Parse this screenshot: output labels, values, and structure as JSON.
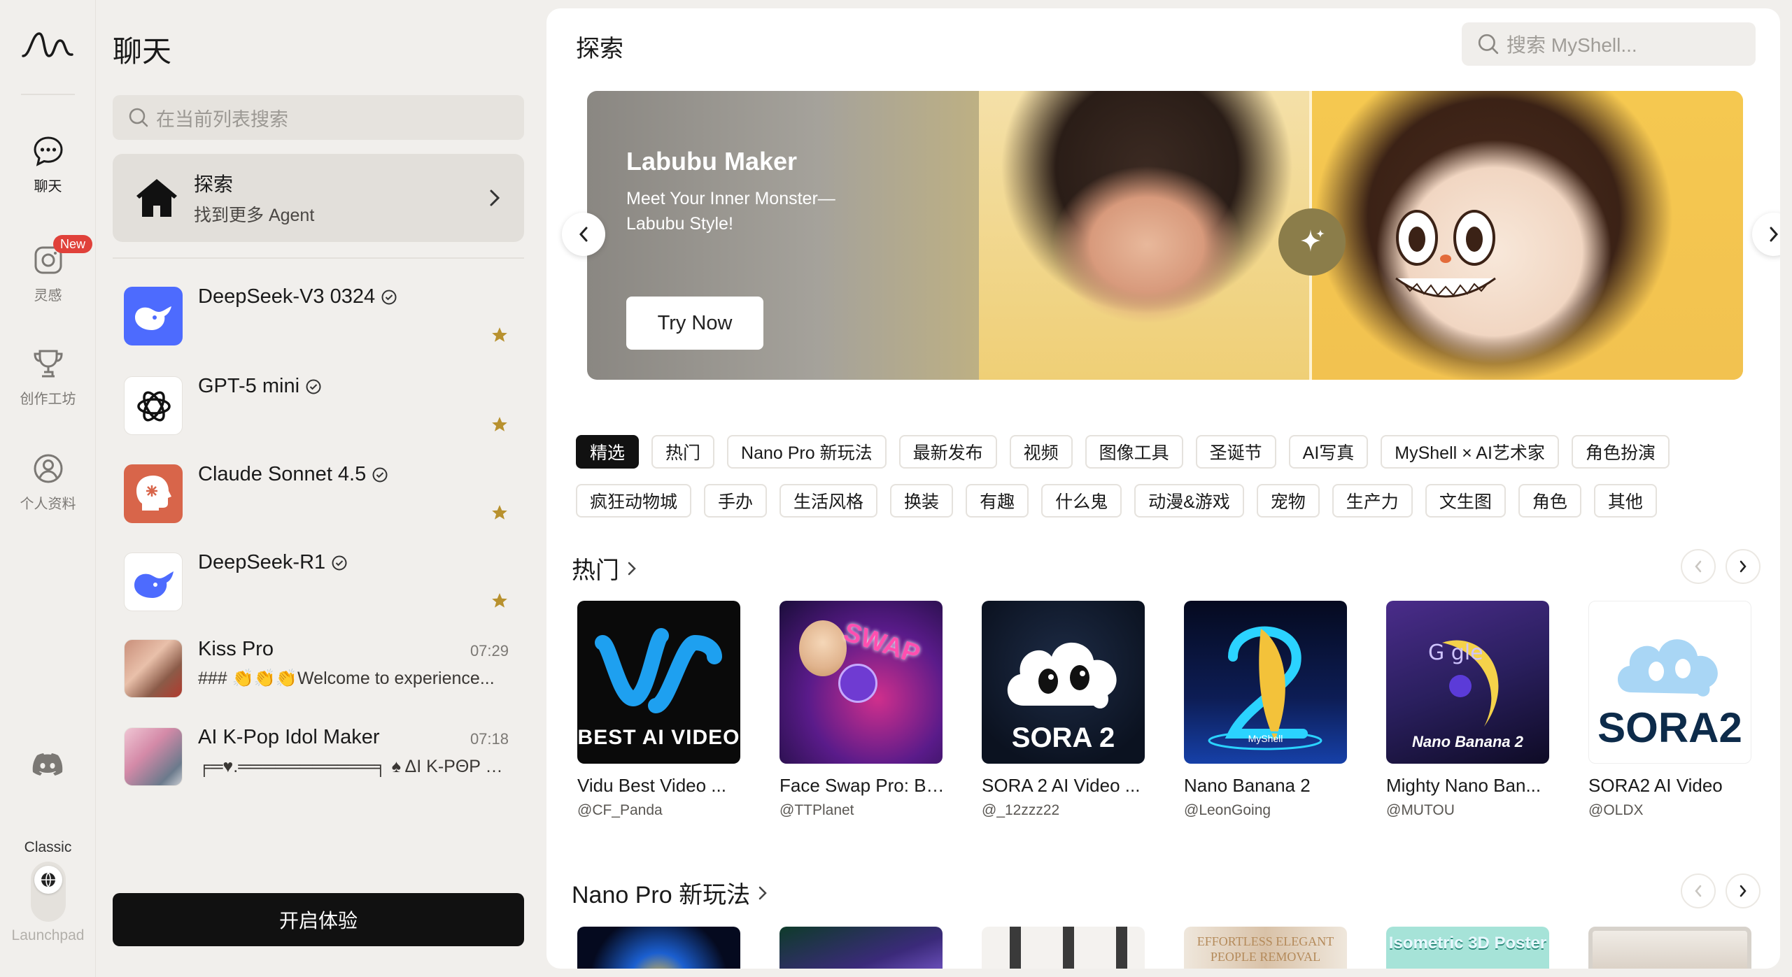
{
  "rail": {
    "items": [
      {
        "label": "聊天",
        "icon": "chat-bubble-icon",
        "active": true
      },
      {
        "label": "灵感",
        "icon": "instagram-icon",
        "badge": "New"
      },
      {
        "label": "创作工坊",
        "icon": "trophy-icon"
      },
      {
        "label": "个人资料",
        "icon": "user-icon"
      }
    ],
    "classic_label": "Classic",
    "launchpad_label": "Launchpad"
  },
  "panel": {
    "title": "聊天",
    "search_placeholder": "在当前列表搜索",
    "explore": {
      "title": "探索",
      "subtitle": "找到更多 Agent"
    },
    "chats": [
      {
        "name": "DeepSeek-V3 0324",
        "verified": true,
        "starred": true
      },
      {
        "name": "GPT-5 mini",
        "verified": true,
        "starred": true
      },
      {
        "name": "Claude Sonnet 4.5",
        "verified": true,
        "starred": true
      },
      {
        "name": "DeepSeek-R1",
        "verified": true,
        "starred": true
      },
      {
        "name": "Kiss Pro",
        "time": "07:29",
        "preview": "### 👏👏👏Welcome to experience..."
      },
      {
        "name": "AI K-Pop Idol Maker",
        "time": "07:18",
        "preview": "╒═♥.═══════════╕ ♠ ΔI K-PΘP MΘ..."
      }
    ],
    "start_button": "开启体验"
  },
  "main": {
    "title": "探索",
    "search_placeholder": "搜索 MyShell...",
    "banner": {
      "title": "Labubu Maker",
      "subtitle": "Meet Your Inner Monster—Labubu Style!",
      "button": "Try Now"
    },
    "chips_row1": [
      "精选",
      "热门",
      "Nano Pro 新玩法",
      "最新发布",
      "视频",
      "图像工具",
      "圣诞节",
      "AI写真",
      "MyShell × AI艺术家",
      "角色扮演"
    ],
    "chips_row2": [
      "疯狂动物城",
      "手办",
      "生活风格",
      "换装",
      "有趣",
      "什么鬼",
      "动漫&游戏",
      "宠物",
      "生产力",
      "文生图",
      "角色",
      "其他"
    ],
    "sections": [
      {
        "title": "热门",
        "cards": [
          {
            "name": "Vidu Best Video ...",
            "author": "@CF_Panda",
            "thumb_text": "BEST AI VIDEO"
          },
          {
            "name": "Face Swap Pro: Be...",
            "author": "@TTPlanet",
            "thumb_text": "SWAP"
          },
          {
            "name": "SORA 2 AI Video ...",
            "author": "@_12zzz22",
            "thumb_text": "SORA 2"
          },
          {
            "name": "Nano Banana 2",
            "author": "@LeonGoing",
            "thumb_text": "MyShell"
          },
          {
            "name": "Mighty Nano Ban...",
            "author": "@MUTOU",
            "thumb_text": "Nano Banana 2"
          },
          {
            "name": "SORA2 AI Video",
            "author": "@OLDX",
            "thumb_text": "SORA2"
          }
        ]
      },
      {
        "title": "Nano Pro 新玩法",
        "cards": [
          {
            "thumb_text": ""
          },
          {
            "thumb_text": ""
          },
          {
            "thumb_text": ""
          },
          {
            "thumb_text": "EFFORTLESS ELEGANT PEOPLE REMOVAL"
          },
          {
            "thumb_text": "Isometric 3D Poster"
          },
          {
            "thumb_text": ""
          }
        ]
      }
    ]
  },
  "colors": {
    "accent_dark": "#111111",
    "badge_red": "#e0413a",
    "star_gold": "#b8912e"
  }
}
